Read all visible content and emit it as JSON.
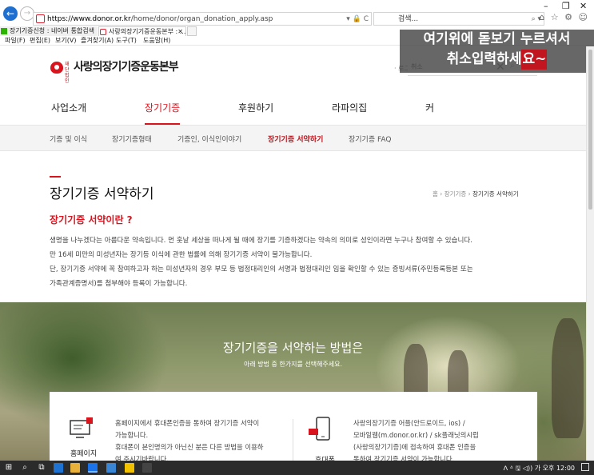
{
  "browser": {
    "url_host": "https://www.donor.or.kr",
    "url_path": "/home/donor/organ_donation_apply.asp",
    "address_tools": "▾ 🔒 C",
    "search_placeholder": "검색...",
    "search_tools": "⌕ ▾",
    "window_controls": [
      "–",
      "❐",
      "✕"
    ],
    "toolbar_icons": "⌂ ☆ ⚙ ☺",
    "tabs": [
      {
        "label": "장기기증신청 : 네이버 통합검색"
      },
      {
        "label": "사랑의장기기증운동본부 : ...",
        "close": "✕"
      }
    ],
    "menu": [
      "파일(F)",
      "편집(E)",
      "보기(V)",
      "즐겨찾기(A)",
      "도구(T)",
      "도움말(H)"
    ]
  },
  "site": {
    "logo_small": "재단 법인",
    "logo_name": "사랑의장기기증운동본부",
    "login_label": "· 로그",
    "search_query": "취소",
    "search_clear": "✕",
    "search_icon": "⌕",
    "search_close": "✕",
    "gnb": [
      "사업소개",
      "장기기증",
      "후원하기",
      "라파의집",
      "커"
    ],
    "gnb_active_index": 1,
    "lnb": [
      "기증 및 이식",
      "장기기증형태",
      "기증인, 이식인이야기",
      "장기기증 서약하기",
      "장기기증 FAQ"
    ],
    "lnb_active_index": 3
  },
  "overlay_tip": {
    "line1": "여기위에 돋보기 누르셔서",
    "line2_prefix": "취소입력하세",
    "line2_highlight": "요~"
  },
  "content": {
    "page_title": "장기기증 서약하기",
    "breadcrumb": [
      "홈",
      "장기기증",
      "장기기증 서약하기"
    ],
    "section_title": "장기기증 서약이란 ?",
    "paragraphs": [
      "생명을 나누겠다는 아름다운 약속입니다. 먼 훗날 세상을 떠나게 될 때에 장기를 기증하겠다는 약속의 의미로 성인이라면 누구나 참여할 수 있습니다.",
      "만 16세 미만의 미성년자는 장기등 이식에 관한 법률에 의해 장기기증 서약이 불가능합니다.",
      "단, 장기기증 서약에 꼭 참여하고자 하는 미성년자의 경우 부모 등 법정대리인의 서명과 법정대리인 임을 확인할 수 있는 증빙서류(주민등록등본 또는",
      "가족관계증명서)를 첨부해야 등록이 가능합니다."
    ],
    "hero_title": "장기기증을 서약하는 방법은",
    "hero_subtitle": "아래 방법 중 한가지를 선택해주세요.",
    "methods": [
      {
        "label": "홈페이지",
        "lines": [
          "홈페이지에서 휴대폰인증을 통하여 장기기증 서약이",
          "가능합니다.",
          "휴대폰이 본인명의가 아닌신 분은 다른 방법을 이용하",
          "여 주시기바랍니다."
        ]
      },
      {
        "label": "휴대폰",
        "lines": [
          "사랑의장기기증 어플(안드로이드, ios) /",
          "모바일웹(m.donor.or.kr) / sk플래닛의시럽",
          "(사랑의장기기증)에 접속하여 휴대폰 인증을",
          "통하여 장기기증 서약이 가능합니다."
        ]
      }
    ]
  },
  "taskbar": {
    "tray_text": "ᐱ ᐞ 🖫 ◁)) 가 오후 12:00"
  }
}
